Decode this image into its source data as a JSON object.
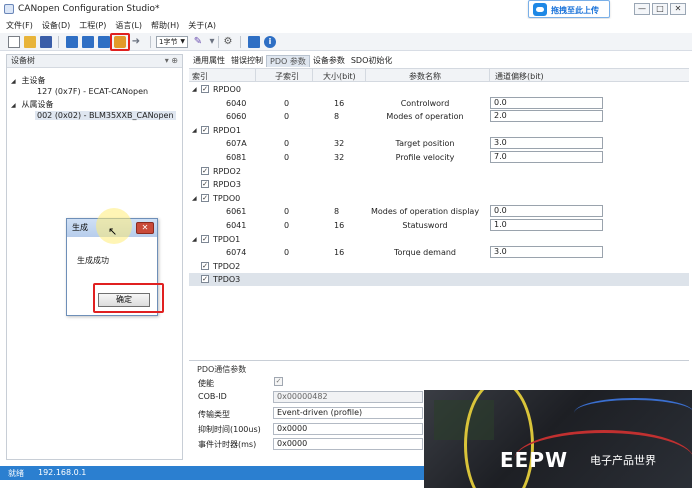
{
  "window": {
    "title": "CANopen Configuration Studio*",
    "controls": [
      "—",
      "□",
      "✕"
    ]
  },
  "upload_widget": {
    "label": "拖拽至此上传"
  },
  "menu": [
    "文件(F)",
    "设备(D)",
    "工程(P)",
    "语言(L)",
    "帮助(H)",
    "关于(A)"
  ],
  "toolbar": {
    "byte_select": "1字节"
  },
  "device_tree": {
    "header": "设备树",
    "pin": "▾ ⊕",
    "items": [
      {
        "label": "主设备",
        "toggle": "◢"
      },
      {
        "label": "127 (0x7F)  -  ECAT-CANopen"
      },
      {
        "label": "从属设备",
        "toggle": "◢"
      },
      {
        "label": "002 (0x02)  -  BLM35XXB_CANopen"
      }
    ]
  },
  "dialog": {
    "title": "生成",
    "close": "✕",
    "message": "生成成功",
    "ok": "确定"
  },
  "tabs": [
    "通用属性",
    "错误控制",
    "PDO 参数",
    "设备参数",
    "SDO初始化"
  ],
  "active_tab": "PDO 参数",
  "pdo_table": {
    "columns": [
      "索引",
      "子索引",
      "大小(bit)",
      "参数名称",
      "通道偏移(bit)"
    ],
    "rows": [
      {
        "type": "group",
        "index": "RPDO0",
        "expanded": true
      },
      {
        "type": "entry",
        "index": "6040",
        "sub": "0",
        "size": "16",
        "name": "Controlword",
        "offset": "0.0"
      },
      {
        "type": "entry",
        "index": "6060",
        "sub": "0",
        "size": "8",
        "name": "Modes of operation",
        "offset": "2.0"
      },
      {
        "type": "group",
        "index": "RPDO1",
        "expanded": true
      },
      {
        "type": "entry",
        "index": "607A",
        "sub": "0",
        "size": "32",
        "name": "Target position",
        "offset": "3.0"
      },
      {
        "type": "entry",
        "index": "6081",
        "sub": "0",
        "size": "32",
        "name": "Profile velocity",
        "offset": "7.0"
      },
      {
        "type": "group",
        "index": "RPDO2",
        "expanded": false
      },
      {
        "type": "group",
        "index": "RPDO3",
        "expanded": false
      },
      {
        "type": "group",
        "index": "TPDO0",
        "expanded": true
      },
      {
        "type": "entry",
        "index": "6061",
        "sub": "0",
        "size": "8",
        "name": "Modes of operation display",
        "offset": "0.0"
      },
      {
        "type": "entry",
        "index": "6041",
        "sub": "0",
        "size": "16",
        "name": "Statusword",
        "offset": "1.0"
      },
      {
        "type": "group",
        "index": "TPDO1",
        "expanded": true
      },
      {
        "type": "entry",
        "index": "6074",
        "sub": "0",
        "size": "16",
        "name": "Torque demand",
        "offset": "3.0"
      },
      {
        "type": "group",
        "index": "TPDO2",
        "expanded": false
      },
      {
        "type": "group",
        "index": "TPDO3",
        "expanded": false,
        "selected": true
      }
    ]
  },
  "pdo_comm": {
    "title": "PDO通信参数",
    "enable_label": "使能",
    "cobid_label": "COB-ID",
    "cobid_value": "0x00000482",
    "transmission_label": "传输类型",
    "transmission_value": "Event-driven (profile)",
    "inhibit_label": "抑制时间(100us)",
    "inhibit_value": "0x0000",
    "event_timer_label": "事件计时器(ms)",
    "event_timer_value": "0x0000"
  },
  "statusbar": {
    "state": "就绪",
    "ip": "192.168.0.1"
  },
  "watermark": {
    "logo": "EEPW",
    "sub": "电子产品世界"
  },
  "colors": {
    "accent": "#2b7fd0",
    "highlight": "#e02020"
  }
}
